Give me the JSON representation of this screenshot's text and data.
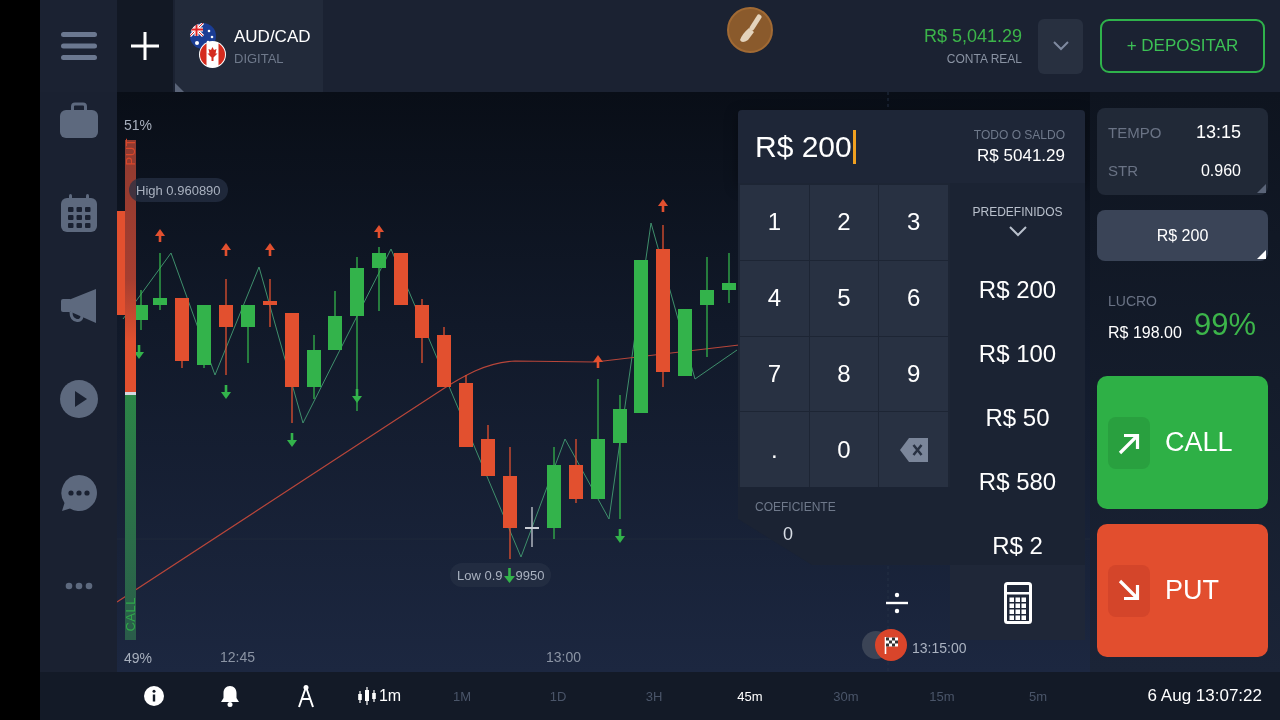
{
  "top_bar": {
    "asset": {
      "name": "AUD/CAD",
      "type": "DIGITAL"
    },
    "balance": {
      "amount": "R$ 5,041.29",
      "label": "CONTA REAL"
    },
    "deposit_button": "+ DEPOSITAR"
  },
  "chart": {
    "sentiment": {
      "put_percent": "51%",
      "put_label": "PUT",
      "call_label": "CALL",
      "call_percent": "49%",
      "level": 0.51
    },
    "high_label": "High 0.960890",
    "low_label_parts": [
      "Low 0.9",
      "9950"
    ],
    "x_ticks": [
      "12:45",
      "13:00"
    ],
    "expiry_time": "13:15:00"
  },
  "amount_keypad": {
    "value": "R$ 200",
    "balance_label": "TODO O SALDO",
    "balance_value": "R$ 5041.29",
    "keys": [
      {
        "kind": "key",
        "label": "1"
      },
      {
        "kind": "key",
        "label": "2"
      },
      {
        "kind": "key",
        "label": "3"
      },
      {
        "kind": "key",
        "label": "4"
      },
      {
        "kind": "key",
        "label": "5"
      },
      {
        "kind": "key",
        "label": "6"
      },
      {
        "kind": "key",
        "label": "7"
      },
      {
        "kind": "key",
        "label": "8"
      },
      {
        "kind": "key",
        "label": "9"
      },
      {
        "kind": "key",
        "label": "."
      },
      {
        "kind": "key",
        "label": "0"
      },
      {
        "kind": "backspace"
      }
    ],
    "presets_label": "PREDEFINIDOS",
    "presets": [
      "R$ 200",
      "R$ 100",
      "R$ 50",
      "R$ 580",
      "R$ 2"
    ],
    "coefficient_label": "COEFICIENTE",
    "coefficient_value": "0"
  },
  "trade_panel": {
    "expiry": {
      "label": "TEMPO",
      "value": "13:15"
    },
    "strike": {
      "label": "STR",
      "value": "0.960"
    },
    "amount": "R$ 200",
    "profit": {
      "label": "LUCRO",
      "value": "R$ 198.00",
      "percent": "99%"
    },
    "call_button": "CALL",
    "put_button": "PUT"
  },
  "bottom_bar": {
    "chart_interval": "1m",
    "timeframes": [
      {
        "label": "1M",
        "selected": false
      },
      {
        "label": "1D",
        "selected": false
      },
      {
        "label": "3H",
        "selected": false
      },
      {
        "label": "45m",
        "selected": true
      },
      {
        "label": "30m",
        "selected": false
      },
      {
        "label": "15m",
        "selected": false
      },
      {
        "label": "5m",
        "selected": false
      }
    ],
    "datetime": "6 Aug 13:07:22"
  }
}
